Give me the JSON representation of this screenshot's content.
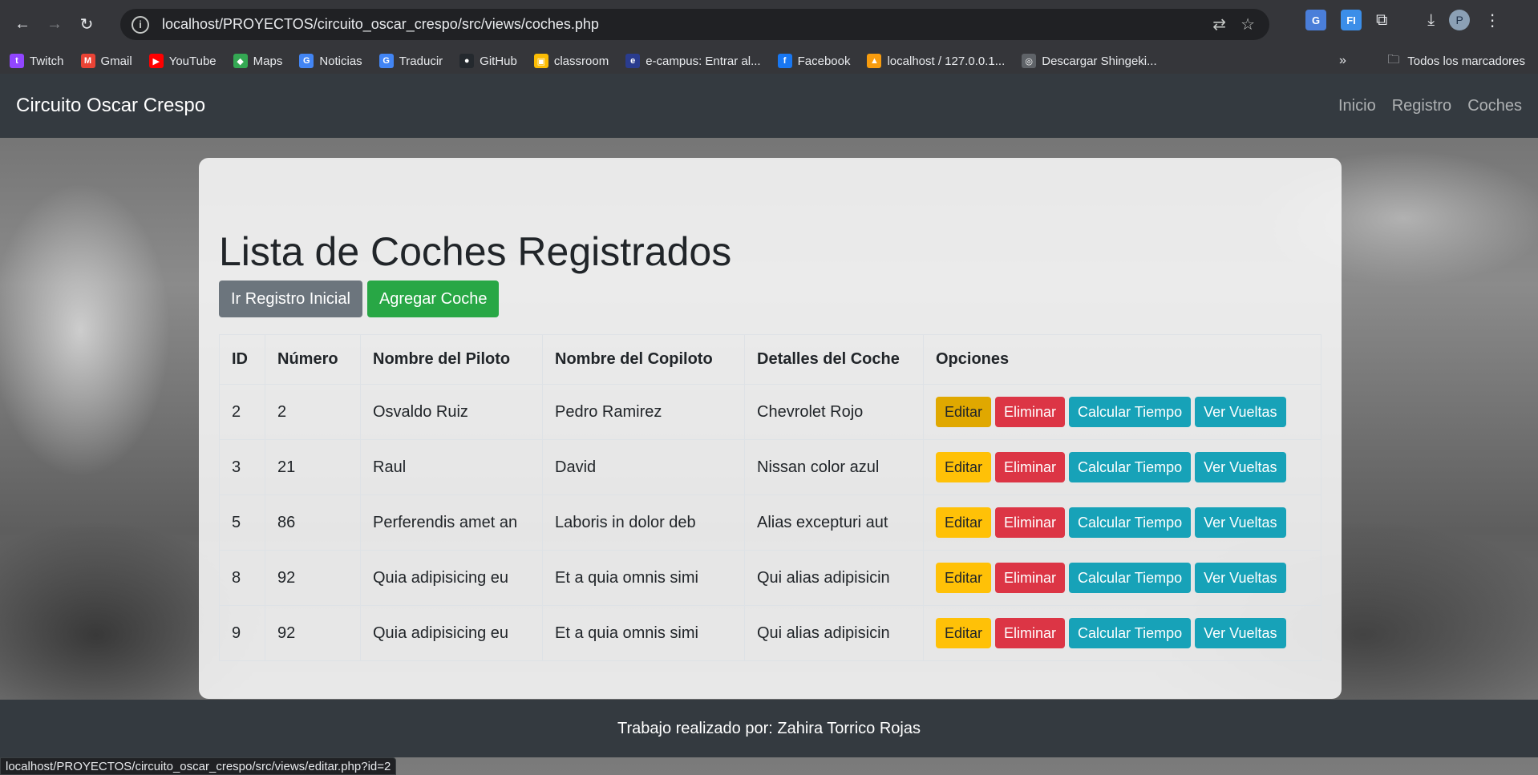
{
  "browser": {
    "url": "localhost/PROYECTOS/circuito_oscar_crespo/src/views/coches.php",
    "bookmarks": [
      {
        "label": "Twitch",
        "color": "#9146ff",
        "glyph": "t"
      },
      {
        "label": "Gmail",
        "color": "#ea4335",
        "glyph": "M"
      },
      {
        "label": "YouTube",
        "color": "#ff0000",
        "glyph": "▶"
      },
      {
        "label": "Maps",
        "color": "#34a853",
        "glyph": "◆"
      },
      {
        "label": "Noticias",
        "color": "#4285f4",
        "glyph": "G"
      },
      {
        "label": "Traducir",
        "color": "#4285f4",
        "glyph": "G"
      },
      {
        "label": "GitHub",
        "color": "#24292e",
        "glyph": "●"
      },
      {
        "label": "classroom",
        "color": "#fbbc04",
        "glyph": "▣"
      },
      {
        "label": "e-campus: Entrar al...",
        "color": "#2a3c8e",
        "glyph": "e"
      },
      {
        "label": "Facebook",
        "color": "#1877f2",
        "glyph": "f"
      },
      {
        "label": "localhost / 127.0.0.1...",
        "color": "#f89c0e",
        "glyph": "▲"
      },
      {
        "label": "Descargar Shingeki...",
        "color": "#5f6368",
        "glyph": "◎"
      }
    ],
    "all_bookmarks_label": "Todos los marcadores",
    "profile_initial": "P",
    "status_url": "localhost/PROYECTOS/circuito_oscar_crespo/src/views/editar.php?id=2"
  },
  "navbar": {
    "brand": "Circuito Oscar Crespo",
    "links": [
      "Inicio",
      "Registro",
      "Coches"
    ]
  },
  "main": {
    "title": "Lista de Coches Registrados",
    "btn_home": "Ir Registro Inicial",
    "btn_add": "Agregar Coche"
  },
  "table": {
    "headers": [
      "ID",
      "Número",
      "Nombre del Piloto",
      "Nombre del Copiloto",
      "Detalles del Coche",
      "Opciones"
    ],
    "rows": [
      {
        "id": "2",
        "numero": "2",
        "piloto": "Osvaldo Ruiz",
        "copiloto": "Pedro Ramirez",
        "detalles": "Chevrolet Rojo"
      },
      {
        "id": "3",
        "numero": "21",
        "piloto": "Raul",
        "copiloto": "David",
        "detalles": "Nissan color azul"
      },
      {
        "id": "5",
        "numero": "86",
        "piloto": "Perferendis amet an",
        "copiloto": "Laboris in dolor deb",
        "detalles": "Alias excepturi aut"
      },
      {
        "id": "8",
        "numero": "92",
        "piloto": "Quia adipisicing eu",
        "copiloto": "Et a quia omnis simi",
        "detalles": "Qui alias adipisicin"
      },
      {
        "id": "9",
        "numero": "92",
        "piloto": "Quia adipisicing eu",
        "copiloto": "Et a quia omnis simi",
        "detalles": "Qui alias adipisicin"
      }
    ],
    "actions": {
      "edit": "Editar",
      "delete": "Eliminar",
      "time": "Calcular Tiempo",
      "laps": "Ver Vueltas"
    }
  },
  "footer": {
    "text": "Trabajo realizado por: Zahira Torrico Rojas"
  },
  "colors": {
    "navbar_bg": "#343a40",
    "secondary": "#6c757d",
    "success": "#28a745",
    "warning": "#ffc107",
    "danger": "#dc3545",
    "info": "#17a2b8"
  }
}
